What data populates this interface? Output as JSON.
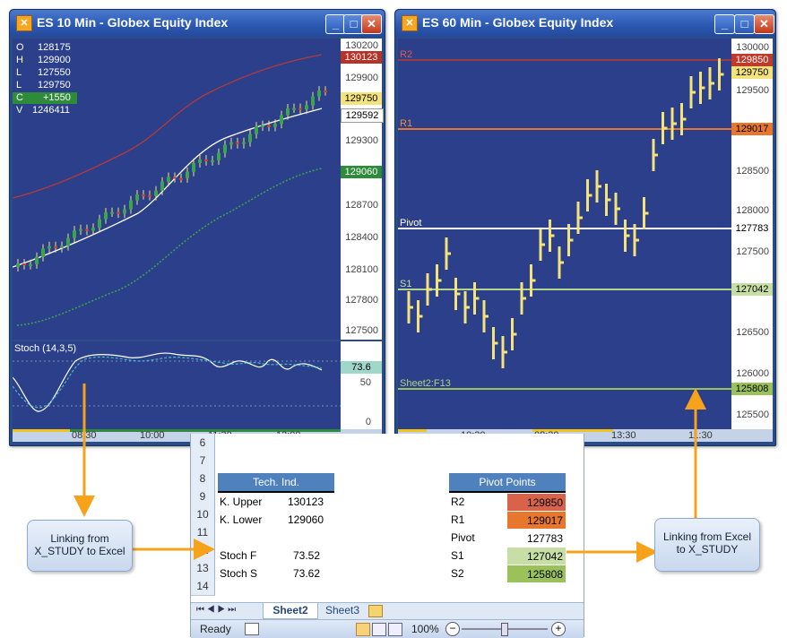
{
  "left_window": {
    "title": "ES 10 Min - Globex Equity Index",
    "ohlc": [
      {
        "k": "O",
        "v": "128175"
      },
      {
        "k": "H",
        "v": "129900"
      },
      {
        "k": "L",
        "v": "127550"
      },
      {
        "k": "L",
        "v": "129750"
      },
      {
        "k": "C",
        "v": "+1550"
      },
      {
        "k": "V",
        "v": "1246411"
      }
    ],
    "price_labels": [
      "130200",
      "129900",
      "129300",
      "128700",
      "128400",
      "128100",
      "127800",
      "127500"
    ],
    "tags": {
      "upper": "130123",
      "last": "129750",
      "mid": "129592",
      "lower": "129060",
      "stoch": "73.6"
    },
    "stoch_title": "Stoch (14,3,5)",
    "stoch_labels": [
      "50",
      "0"
    ],
    "time_labels": [
      "08:30",
      "10:00",
      "11:30",
      "13:00"
    ]
  },
  "right_window": {
    "title": "ES 60 Min - Globex Equity Index",
    "price_labels": [
      "130000",
      "129500",
      "128500",
      "128000",
      "127500",
      "126500",
      "126000",
      "125500"
    ],
    "lines": [
      {
        "label": "R2",
        "tag": "129850",
        "color": "#c0392b"
      },
      {
        "label": "R1",
        "tag": "129017",
        "color": "#e8772e"
      },
      {
        "label": "Pivot",
        "tag": "127783",
        "color": "#ffffff"
      },
      {
        "label": "S1",
        "tag": "127042",
        "color": "#b5d48a"
      },
      {
        "label": "Sheet2:F13",
        "tag": "125808",
        "color": "#9bc25a"
      }
    ],
    "last_tag": "129750",
    "time_labels": [
      "10:30",
      "08:30",
      "13:30",
      "11:30"
    ]
  },
  "excel": {
    "rows": [
      "6",
      "7",
      "8",
      "9",
      "10",
      "11",
      "12",
      "13",
      "14"
    ],
    "tech_header": "Tech. Ind.",
    "tech": [
      {
        "name": "K. Upper",
        "value": "130123"
      },
      {
        "name": "K. Lower",
        "value": "129060"
      },
      {
        "name": "",
        "value": ""
      },
      {
        "name": "Stoch F",
        "value": "73.52"
      },
      {
        "name": "Stoch S",
        "value": "73.62"
      }
    ],
    "pivot_header": "Pivot Points",
    "pivots": [
      {
        "name": "R2",
        "value": "129850",
        "color": "#d9634a"
      },
      {
        "name": "R1",
        "value": "129017",
        "color": "#e8772e"
      },
      {
        "name": "Pivot",
        "value": "127783",
        "color": "#ffffff"
      },
      {
        "name": "S1",
        "value": "127042",
        "color": "#c7dfa6"
      },
      {
        "name": "S2",
        "value": "125808",
        "color": "#9bc25a"
      }
    ],
    "tabs": [
      "Sheet2",
      "Sheet3"
    ],
    "status": "Ready",
    "zoom": "100%"
  },
  "callouts": {
    "left": "Linking from X_STUDY to Excel",
    "right": "Linking from Excel to X_STUDY"
  },
  "colors": {
    "arrow": "#f7a21b"
  }
}
